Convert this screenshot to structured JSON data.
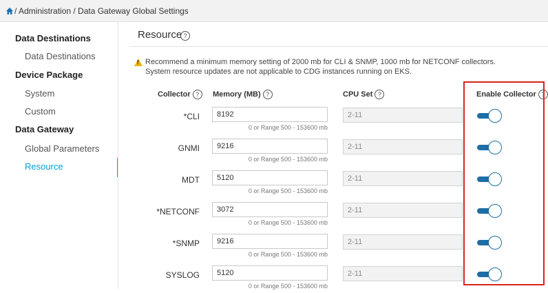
{
  "breadcrumb": {
    "text": "/ Administration / Data Gateway Global Settings",
    "home_icon": "home-icon"
  },
  "sidebar": {
    "groups": [
      {
        "label": "Data Destinations",
        "items": [
          {
            "label": "Data Destinations"
          }
        ]
      },
      {
        "label": "Device Package",
        "items": [
          {
            "label": "System"
          },
          {
            "label": "Custom"
          }
        ]
      },
      {
        "label": "Data Gateway",
        "items": [
          {
            "label": "Global Parameters"
          },
          {
            "label": "Resource",
            "active": true
          }
        ]
      }
    ],
    "accent_color": "#049fd9"
  },
  "main": {
    "title": "Resource",
    "help_glyph": "?",
    "note": {
      "line1": "Recommend a minimum memory setting of 2000 mb for CLI & SNMP, 1000 mb for NETCONF collectors.",
      "line2": "System resource updates are not applicable to CDG instances running on EKS.",
      "icon": "warning-icon",
      "warning_glyph": "!"
    },
    "columns": {
      "collector": "Collector",
      "memory": "Memory (MB)",
      "cpu": "CPU Set",
      "enable": "Enable Collector"
    },
    "rows": [
      {
        "collector": "*CLI",
        "memory": "8192",
        "hint": "0 or Range 500 - 153600 mb",
        "cpu": "2-11",
        "enabled": true
      },
      {
        "collector": "GNMI",
        "memory": "9216",
        "hint": "0 or Range 500 - 153600 mb",
        "cpu": "2-11",
        "enabled": true
      },
      {
        "collector": "MDT",
        "memory": "5120",
        "hint": "0 or Range 500 - 153600 mb",
        "cpu": "2-11",
        "enabled": true
      },
      {
        "collector": "*NETCONF",
        "memory": "3072",
        "hint": "0 or Range 500 - 153600 mb",
        "cpu": "2-11",
        "enabled": true
      },
      {
        "collector": "*SNMP",
        "memory": "9216",
        "hint": "0 or Range 500 - 153600 mb",
        "cpu": "2-11",
        "enabled": true
      },
      {
        "collector": "SYSLOG",
        "memory": "5120",
        "hint": "0 or Range 500 - 153600 mb",
        "cpu": "2-11",
        "enabled": true
      }
    ],
    "toggle_color": "#1c6ea4",
    "highlight_color": "#d9221a"
  }
}
